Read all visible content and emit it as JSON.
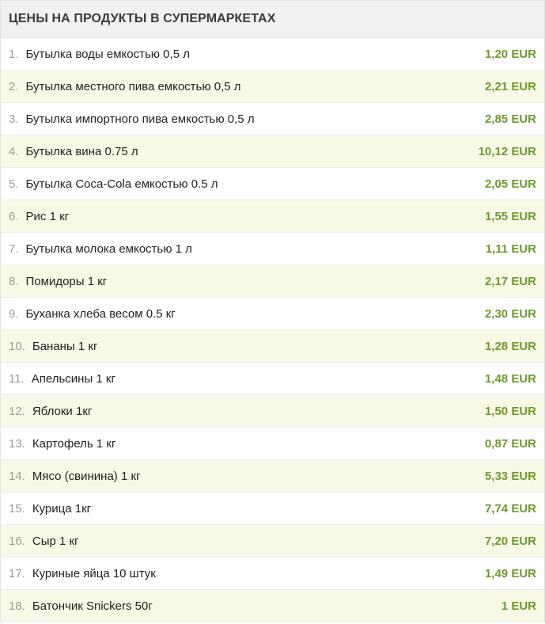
{
  "header": {
    "title": "ЦЕНЫ НА ПРОДУКТЫ В СУПЕРМАРКЕТАХ"
  },
  "colors": {
    "price": "#6c9a2c",
    "row_alt": "#f8f8e6",
    "header_bg": "#f1f1f1"
  },
  "items": [
    {
      "num": "1.",
      "name": "Бутылка воды емкостью 0,5 л",
      "price": "1,20 EUR"
    },
    {
      "num": "2.",
      "name": "Бутылка местного пива емкостью 0,5 л",
      "price": "2,21 EUR"
    },
    {
      "num": "3.",
      "name": "Бутылка импортного пива емкостью 0,5 л",
      "price": "2,85 EUR"
    },
    {
      "num": "4.",
      "name": "Бутылка вина 0.75 л",
      "price": "10,12 EUR"
    },
    {
      "num": "5.",
      "name": "Бутылка Coca-Cola емкостью 0.5 л",
      "price": "2,05 EUR"
    },
    {
      "num": "6.",
      "name": "Рис 1 кг",
      "price": "1,55 EUR"
    },
    {
      "num": "7.",
      "name": "Бутылка молока емкостью 1 л",
      "price": "1,11 EUR"
    },
    {
      "num": "8.",
      "name": "Помидоры 1 кг",
      "price": "2,17 EUR"
    },
    {
      "num": "9.",
      "name": "Буханка хлеба весом 0.5 кг",
      "price": "2,30 EUR"
    },
    {
      "num": "10.",
      "name": "Бананы 1 кг",
      "price": "1,28 EUR"
    },
    {
      "num": "11.",
      "name": "Апельсины 1 кг",
      "price": "1,48 EUR"
    },
    {
      "num": "12.",
      "name": "Яблоки 1кг",
      "price": "1,50 EUR"
    },
    {
      "num": "13.",
      "name": "Картофель 1 кг",
      "price": "0,87 EUR"
    },
    {
      "num": "14.",
      "name": "Мясо (свинина) 1 кг",
      "price": "5,33 EUR"
    },
    {
      "num": "15.",
      "name": "Курица 1кг",
      "price": "7,74 EUR"
    },
    {
      "num": "16.",
      "name": "Сыр 1 кг",
      "price": "7,20 EUR"
    },
    {
      "num": "17.",
      "name": "Куриные яйца 10 штук",
      "price": "1,49 EUR"
    },
    {
      "num": "18.",
      "name": "Батончик Snickers 50г",
      "price": "1 EUR"
    }
  ]
}
